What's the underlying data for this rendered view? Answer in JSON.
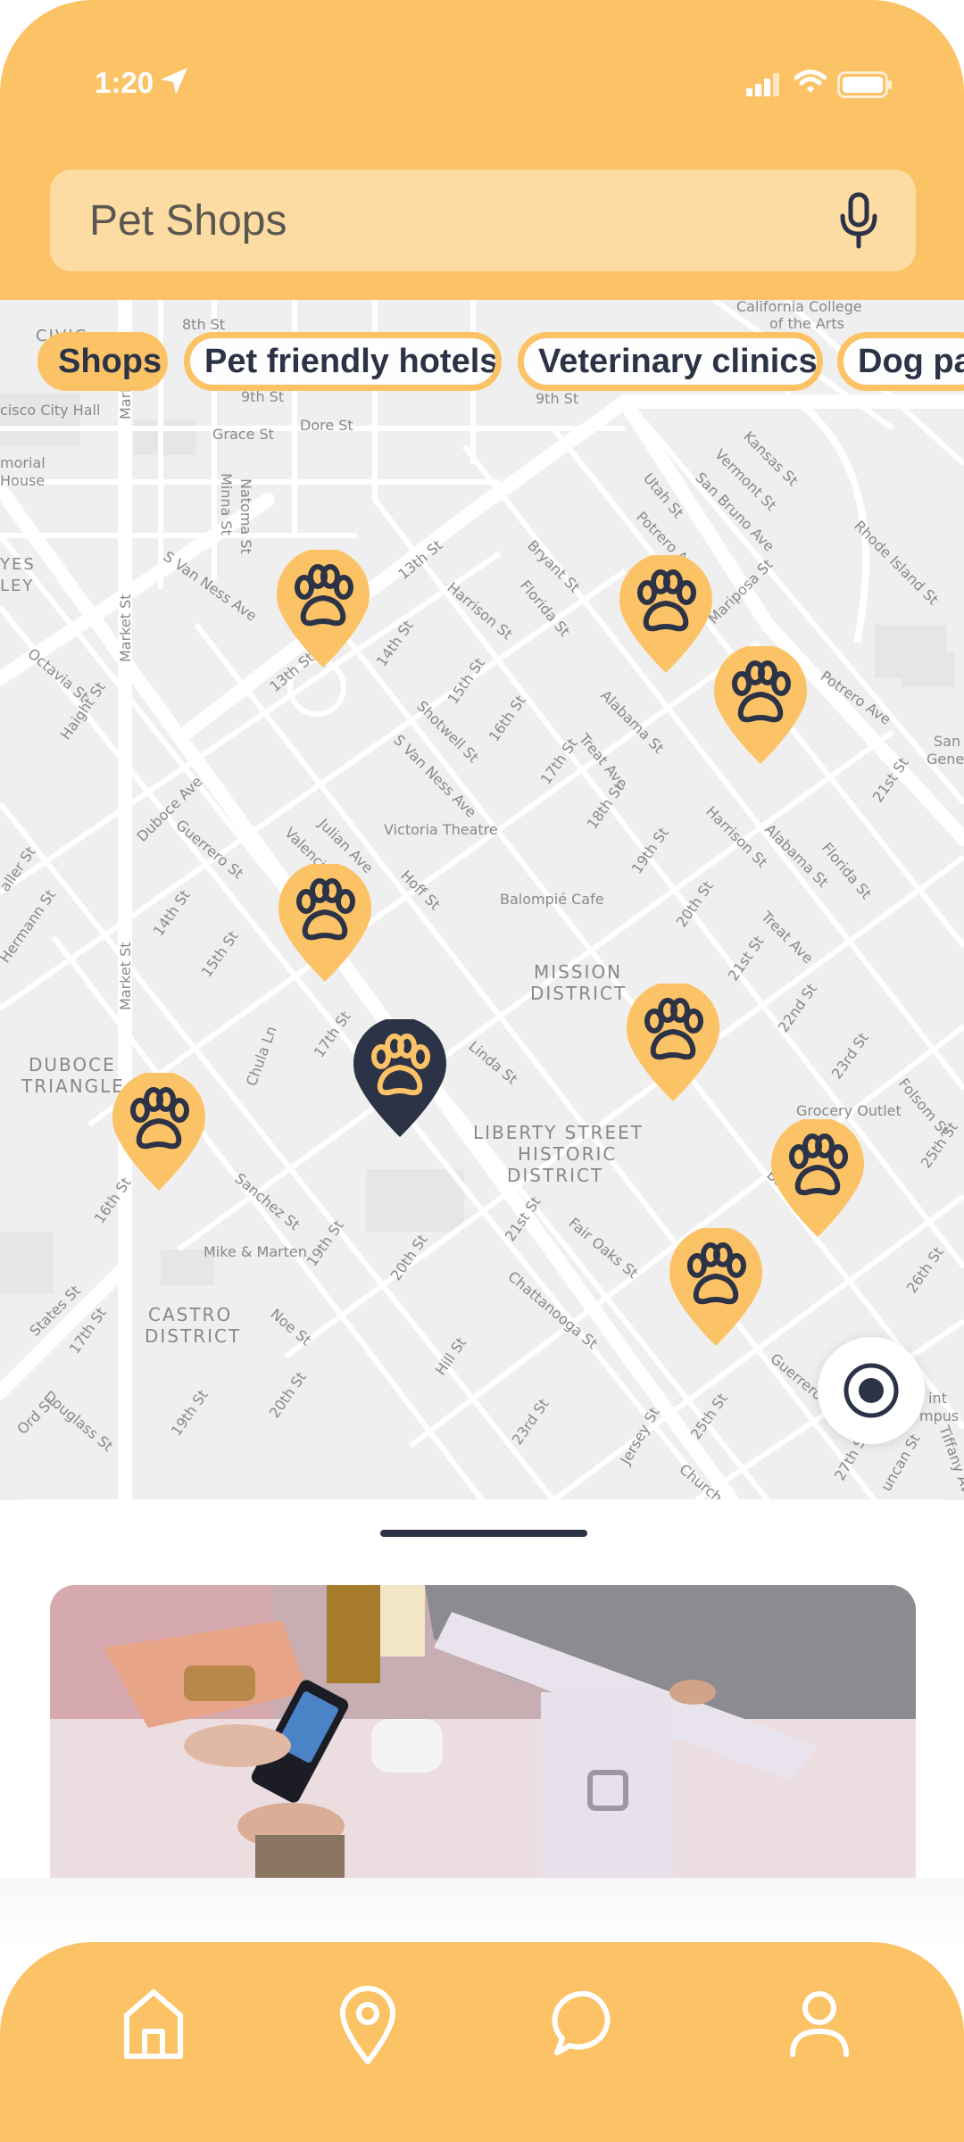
{
  "status_bar": {
    "time": "1:20",
    "icons": [
      "location-arrow-icon",
      "cellular-signal-icon",
      "wifi-icon",
      "battery-icon"
    ]
  },
  "search": {
    "value": "Pet Shops",
    "icon": "microphone-icon"
  },
  "filters": [
    {
      "label": "Shops",
      "active": true
    },
    {
      "label": "Pet friendly hotels",
      "active": false
    },
    {
      "label": "Veterinary clinics",
      "active": false
    },
    {
      "label": "Dog pa",
      "active": false
    }
  ],
  "map": {
    "labels": {
      "california_college": "California College",
      "of_the_arts": "of the Arts",
      "civic": "CIVIC",
      "francisco_city_hall": "cisco City Hall",
      "memorial": "morial",
      "house": "House",
      "yes": "YES",
      "ley": "LEY",
      "eighth_st": "8th St",
      "ninth_st_a": "9th St",
      "ninth_st_b": "9th St",
      "grace_st": "Grace St",
      "dore_st": "Dore St",
      "minna_st": "Minna St",
      "natoma_st": "Natoma St",
      "market_st_top": "Market St",
      "market_st_mid": "Market St",
      "market_st_low": "Market St",
      "s_van_ness_a": "S Van Ness Ave",
      "s_van_ness_b": "S Van Ness Ave",
      "thirteenth_a": "13th St",
      "thirteenth_b": "13th St",
      "fourteenth_a": "14th St",
      "fourteenth_b": "14th St",
      "fifteenth_a": "15th St",
      "fifteenth_b": "15th St",
      "sixteenth_a": "16th St",
      "sixteenth_b": "16th St",
      "seventeenth_a": "17th St",
      "seventeenth_b": "17th St",
      "seventeenth_c": "17th St",
      "eighteenth": "18th St",
      "nineteenth_a": "19th St",
      "nineteenth_b": "19th St",
      "nineteenth_c": "19th St",
      "twentieth_a": "20th St",
      "twentieth_b": "20th St",
      "twentieth_c": "20th St",
      "twentyfirst_a": "21st St",
      "twentyfirst_b": "21st St",
      "twentyfirst_c": "21st St",
      "twentysecond": "22nd St",
      "twentythird_a": "23rd St",
      "twentythird_b": "23rd St",
      "twentyfifth_a": "25th St",
      "twentyfifth_b": "25th St",
      "twentysixth": "26th St",
      "twentyseventh": "27th St",
      "harrison_a": "Harrison St",
      "harrison_b": "Harrison St",
      "florida_a": "Florida St",
      "florida_b": "Florida St",
      "bryant": "Bryant St",
      "potrero_a": "Potrero Ave",
      "potrero_b": "Potrero Ave",
      "utah": "Utah St",
      "san_bruno": "San Bruno Ave",
      "vermont": "Vermont St",
      "kansas": "Kansas St",
      "rhode_island": "Rhode Island St",
      "mariposa": "Mariposa St",
      "alabama_a": "Alabama St",
      "alabama_b": "Alabama St",
      "treat_a": "Treat Ave",
      "treat_b": "Treat Ave",
      "shotwell": "Shotwell St",
      "julian": "Julian Ave",
      "valencia": "Valencia St",
      "hoff": "Hoff St",
      "guerrero_a": "Guerrero St",
      "guerrero_b": "Guerrero St",
      "duboce_ave": "Duboce Ave",
      "octavia": "Octavia St",
      "haight": "Haight St",
      "waller": "aller St",
      "hermann": "Hermann St",
      "chula": "Chula Ln",
      "linda": "Linda St",
      "sanchez": "Sanchez St",
      "noe": "Noe St",
      "hill": "Hill St",
      "states": "States St",
      "douglass": "Douglass St",
      "ord": "Ord St",
      "chattanooga": "Chattanooga St",
      "fair_oaks": "Fair Oaks St",
      "bartlett": "Bartlett St",
      "folsom": "Folsom St",
      "jersey": "Jersey St",
      "church": "Church St",
      "tiffany": "Tiffany Ave",
      "duncan": "uncan St",
      "victoria_theatre": "Victoria Theatre",
      "balompie_cafe": "Balompié Cafe",
      "mission_district_1": "MISSION",
      "mission_district_2": "DISTRICT",
      "liberty_1": "LIBERTY STREET",
      "liberty_2": "HISTORIC",
      "liberty_3": "DISTRICT",
      "duboce_tri_1": "DUBOCE",
      "duboce_tri_2": "TRIANGLE",
      "castro_1": "CASTRO",
      "castro_2": "DISTRICT",
      "mike_marten": "Mike & Marten",
      "grocery_outlet": "Grocery Outlet",
      "san_gen_1": "San",
      "san_gen_2": "Gener",
      "campus_1": "int",
      "campus_2": "mpus"
    },
    "pins": [
      {
        "name": "pet-shop-pin-1",
        "selected": false
      },
      {
        "name": "pet-shop-pin-2",
        "selected": false
      },
      {
        "name": "pet-shop-pin-3",
        "selected": false
      },
      {
        "name": "pet-shop-pin-4",
        "selected": false
      },
      {
        "name": "pet-shop-pin-5",
        "selected": true
      },
      {
        "name": "pet-shop-pin-6",
        "selected": false
      },
      {
        "name": "pet-shop-pin-7",
        "selected": false
      },
      {
        "name": "pet-shop-pin-8",
        "selected": false
      },
      {
        "name": "pet-shop-pin-9",
        "selected": false
      }
    ]
  },
  "nav": [
    {
      "name": "home-icon"
    },
    {
      "name": "map-pin-icon"
    },
    {
      "name": "chat-bubble-icon"
    },
    {
      "name": "profile-icon"
    }
  ],
  "colors": {
    "accent": "#fcc266",
    "accent_light": "#fcdca3",
    "navy": "#2c3346",
    "map_bg": "#efefef"
  }
}
